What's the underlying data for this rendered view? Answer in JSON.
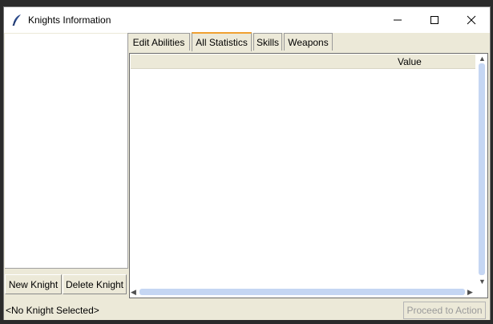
{
  "window": {
    "title": "Knights Information",
    "icon": "feather-icon"
  },
  "sidebar": {
    "new_label": "New Knight",
    "delete_label": "Delete Knight"
  },
  "tabs": [
    {
      "label": "Edit Abilities",
      "active": false
    },
    {
      "label": "All Statistics",
      "active": true
    },
    {
      "label": "Skills",
      "active": false
    },
    {
      "label": "Weapons",
      "active": false
    }
  ],
  "table": {
    "columns": [
      "",
      "Value"
    ],
    "rows": []
  },
  "status": {
    "text": "<No Knight Selected>",
    "proceed_label": "Proceed to Action",
    "proceed_enabled": false
  },
  "colors": {
    "accent_tab": "#f0a030",
    "scroll_thumb": "#c5d6f3"
  }
}
